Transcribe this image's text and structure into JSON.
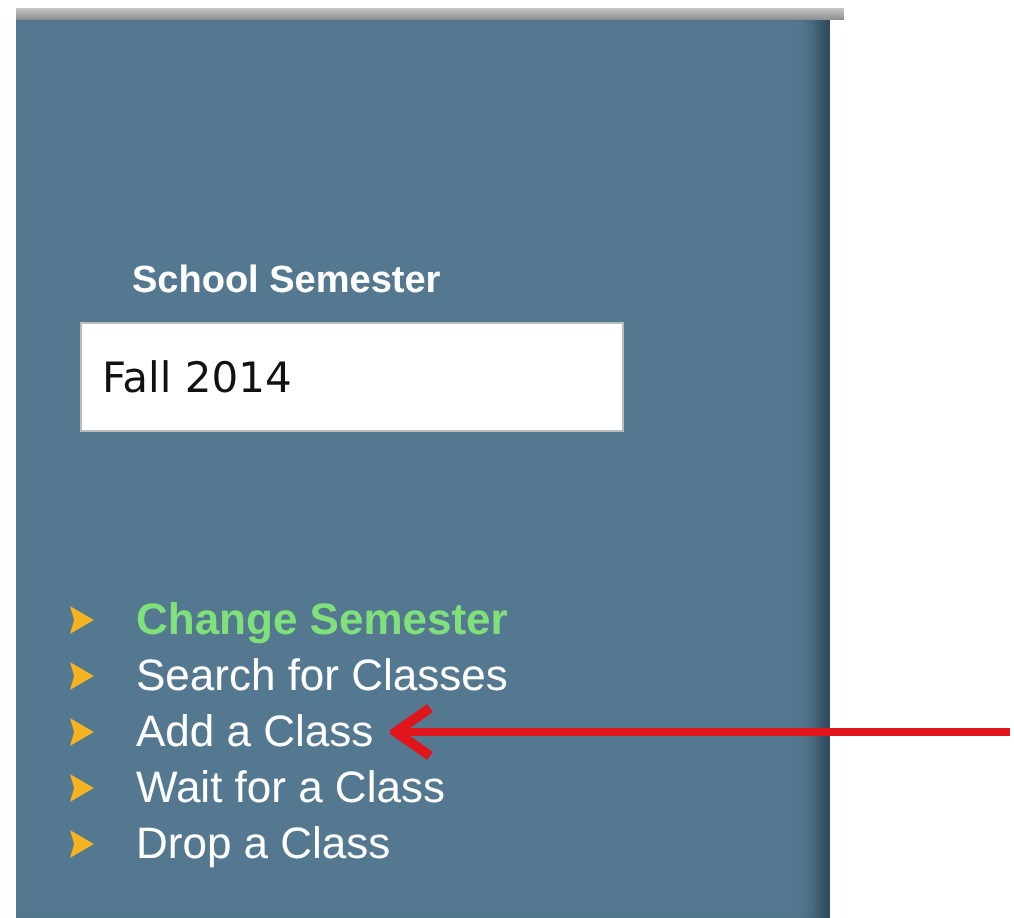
{
  "semester_box": {
    "label": "School Semester",
    "value": "Fall 2014"
  },
  "menu": [
    {
      "label": "Change Semester",
      "selected": true,
      "pointed_at": false
    },
    {
      "label": "Search for Classes",
      "selected": false,
      "pointed_at": false
    },
    {
      "label": "Add a Class",
      "selected": false,
      "pointed_at": true
    },
    {
      "label": "Wait for a Class",
      "selected": false,
      "pointed_at": false
    },
    {
      "label": "Drop a Class",
      "selected": false,
      "pointed_at": false
    }
  ]
}
